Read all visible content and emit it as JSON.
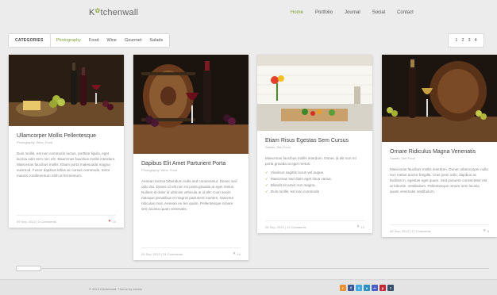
{
  "header": {
    "logo_prefix": "K",
    "logo_rest": "tchenwall",
    "nav": [
      {
        "label": "Home",
        "active": true
      },
      {
        "label": "Portfolio",
        "active": false
      },
      {
        "label": "Journal",
        "active": false
      },
      {
        "label": "Social",
        "active": false
      },
      {
        "label": "Contact",
        "active": false
      }
    ]
  },
  "filters": {
    "label": "CATEGORIES",
    "items": [
      {
        "label": "Photography",
        "active": true
      },
      {
        "label": "Food",
        "active": false
      },
      {
        "label": "Wine",
        "active": false
      },
      {
        "label": "Gourmet",
        "active": false
      },
      {
        "label": "Salads",
        "active": false
      }
    ]
  },
  "pager": [
    "1",
    "2",
    "3",
    "4"
  ],
  "cards": [
    {
      "title": "Ullamcorper Mollis Pellentesque",
      "sub": "Photography, Wine, Food",
      "text": "Duis mollis, est non commodo luctus, porttitor ligula, eget lacinia odio sem nec elit. Maecenas faucibus mollis interdum. Maecenas faucibus mollis. Etiam porta malesuada magna euismod. Fusce dapibus tellus ac cursus commodo, tortor mauris condimentum nibh ut fermentum.",
      "meta": "09 Sep, 2012  |  3 Comments",
      "likes": "10",
      "liked": true
    },
    {
      "title": "Dapibus Elit Amet Parturient Porta",
      "sub": "Photography, Wine, Food",
      "text": "Aenean lacinia bibendum nulla sed consectetur. Donec sed odio dui. Donec id elit non mi porta gravida at eget metus. Nullam id dolor id ultricies vehicula ut id elit. Cum sociis natoque penatibus et magnis parturient montes, nascetur ridiculus mus. Aenean eu leo quam. Pellentesque ornare sem lacinia quam venenatis.",
      "meta": "24 Sep, 2012  |  24 Comments",
      "likes": "14",
      "liked": false
    },
    {
      "title": "Etiam Risus Egestas Sem Cursus",
      "sub": "Salads, Diet Food",
      "text": "Maecenas faucibus mollis interdum. Donec id elit non mi porta gravida at eget metus.",
      "list": [
        "Vivamus sagittis lacus vel augue.",
        "Maecenas sed diam eget risus varius.",
        "Blandit sit amet non magna.",
        "Duis mollis, est non commodo"
      ],
      "meta": "28 Sep, 2012  |  11 Comments",
      "likes": "12",
      "liked": false
    },
    {
      "title": "Ornare Ridiculus Magna Venenatis",
      "sub": "Salads, Diet Food",
      "text": "Maecenas faucibus mollis interdum. Donec ullamcorper nulla non metus auctor fringilla. Cras justo odio, dapibus ac facilisis in, egestas eget quam. Sed posuere consectetur est at lobortis. Vestibulum. Pellentesque ornare sem lacinia quam venenatis vestibulum.",
      "meta": "09 Sep, 2012  |  17 Comments",
      "likes": "8",
      "liked": false
    }
  ],
  "footer": {
    "copy": "© 2013 Kitchenwall. Theme by elemis",
    "social": [
      {
        "icon": "rss-icon",
        "glyph": "r",
        "color": "#e8912e"
      },
      {
        "icon": "facebook-icon",
        "glyph": "f",
        "color": "#3b5998"
      },
      {
        "icon": "twitter-icon",
        "glyph": "t",
        "color": "#3fa9e0"
      },
      {
        "icon": "vimeo-icon",
        "glyph": "v",
        "color": "#2a8fc1"
      },
      {
        "icon": "flickr-icon",
        "glyph": "••",
        "color": "#4a5fc7"
      },
      {
        "icon": "pinterest-icon",
        "glyph": "p",
        "color": "#c2282e"
      },
      {
        "icon": "tumblr-icon",
        "glyph": "t",
        "color": "#34506b"
      }
    ]
  }
}
